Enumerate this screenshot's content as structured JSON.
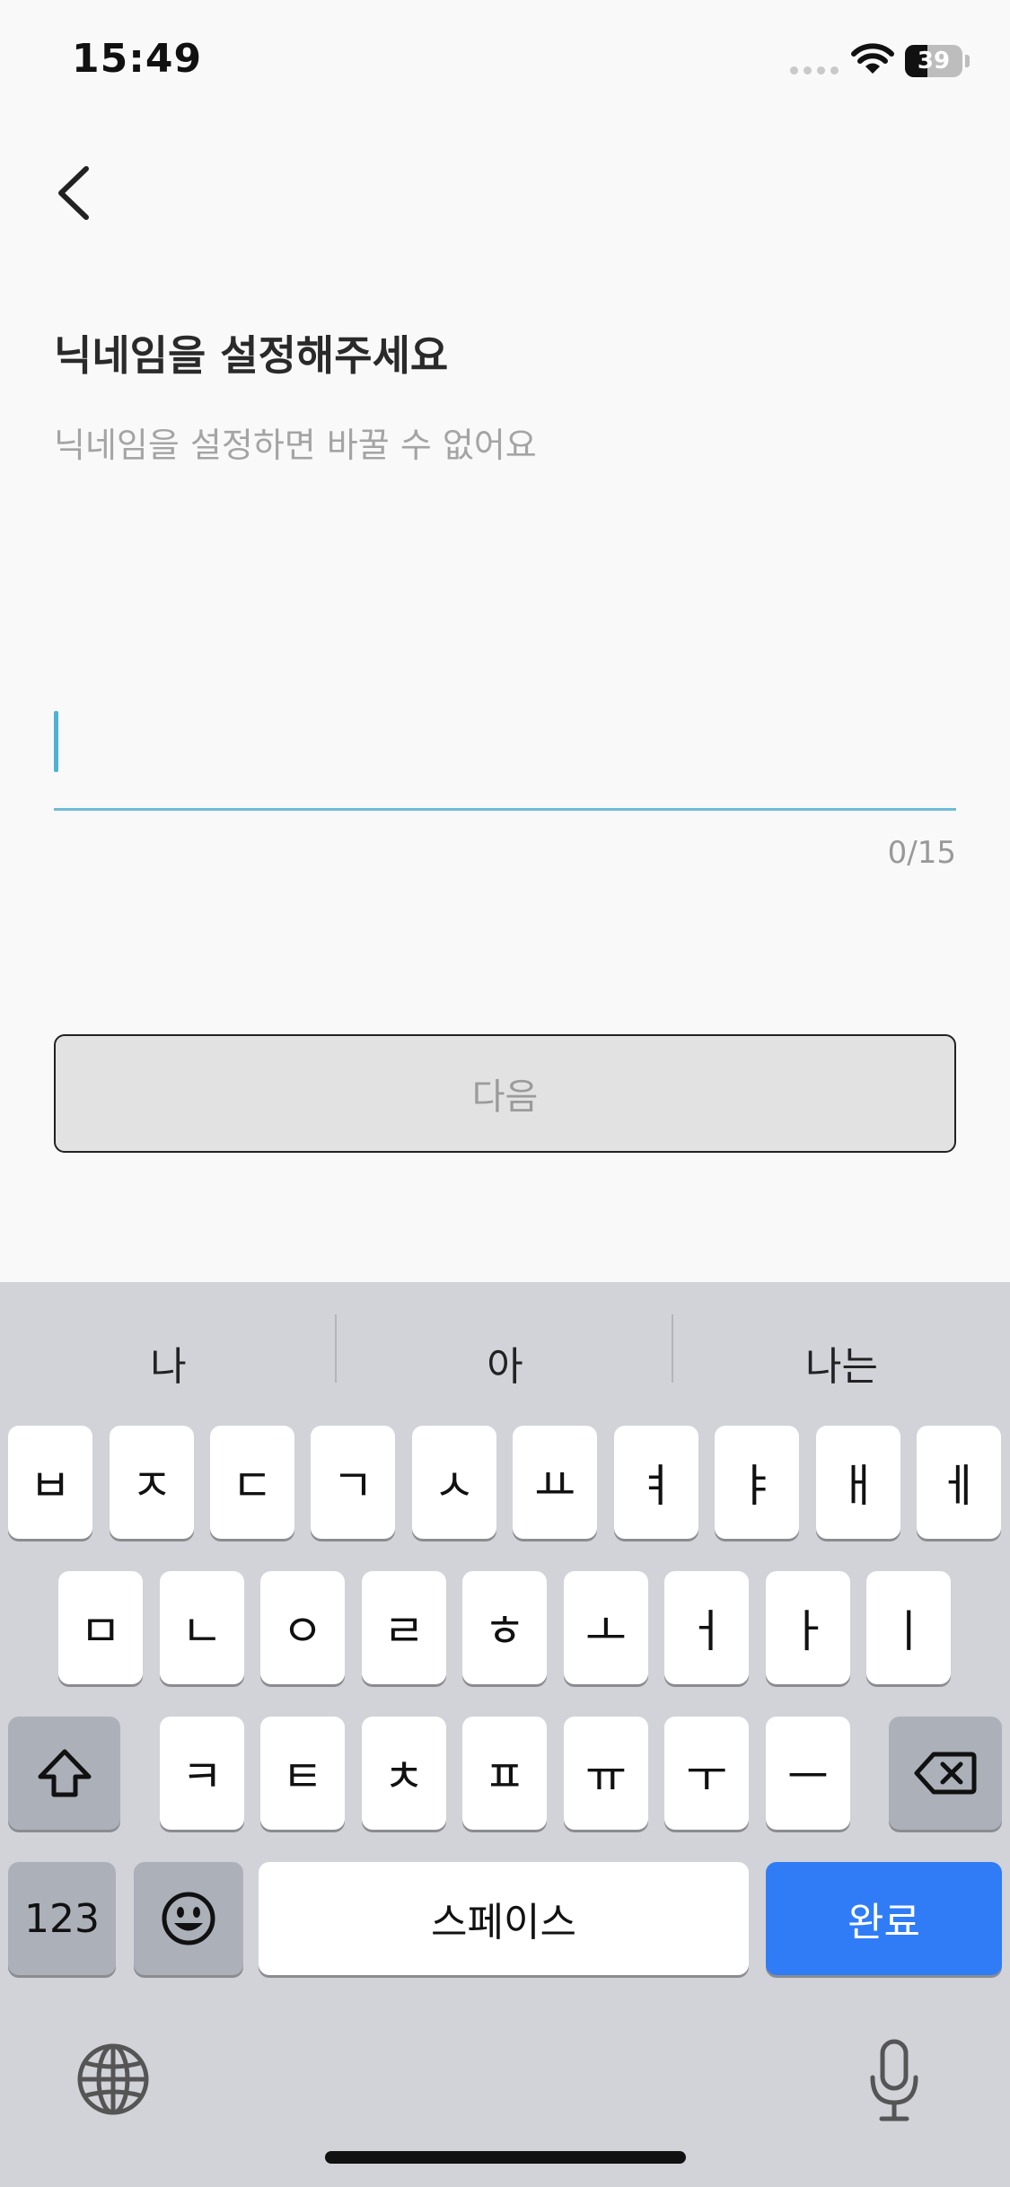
{
  "status_bar": {
    "time": "15:49",
    "battery": "39",
    "battery_level": 0.39
  },
  "screen": {
    "title": "닉네임을 설정해주세요",
    "subtitle": "닉네임을 설정하면 바꿀 수 없어요",
    "input": {
      "value": "",
      "placeholder": ""
    },
    "counter": "0/15",
    "next_button": "다음"
  },
  "keyboard": {
    "suggestions": [
      "나",
      "아",
      "나는"
    ],
    "row1": [
      "ㅂ",
      "ㅈ",
      "ㄷ",
      "ㄱ",
      "ㅅ",
      "ㅛ",
      "ㅕ",
      "ㅑ",
      "ㅐ",
      "ㅔ"
    ],
    "row2": [
      "ㅁ",
      "ㄴ",
      "ㅇ",
      "ㄹ",
      "ㅎ",
      "ㅗ",
      "ㅓ",
      "ㅏ",
      "ㅣ"
    ],
    "row3": [
      "ㅋ",
      "ㅌ",
      "ㅊ",
      "ㅍ",
      "ㅠ",
      "ㅜ",
      "ㅡ"
    ],
    "numbers_key": "123",
    "space_key": "스페이스",
    "done_key": "완료"
  },
  "colors": {
    "accent": "#4db3d3",
    "keyboard_bg": "#d1d3d9",
    "done_blue": "#2f7cf6"
  }
}
